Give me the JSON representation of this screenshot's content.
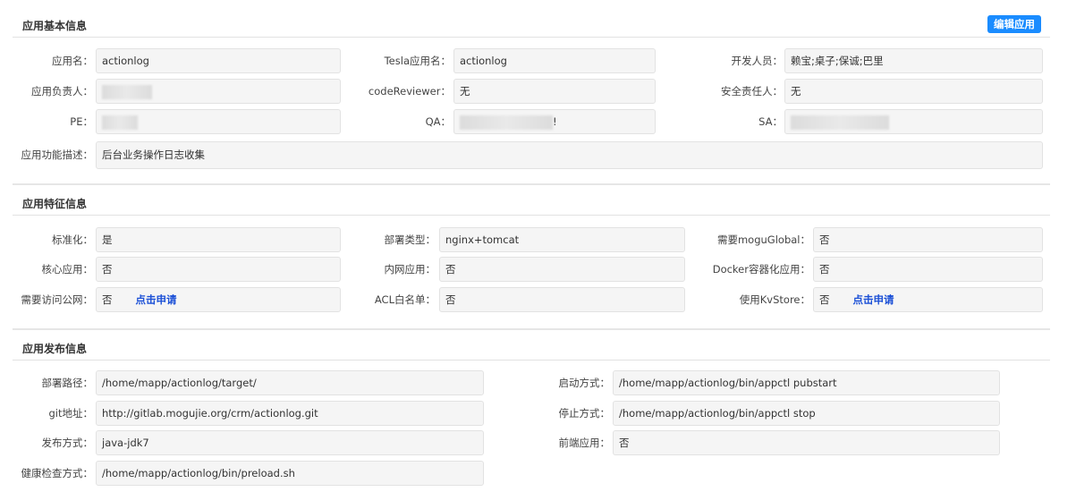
{
  "basic": {
    "title": "应用基本信息",
    "edit_button": "编辑应用",
    "labels": {
      "app_name": "应用名：",
      "tesla_name": "Tesla应用名：",
      "developers": "开发人员：",
      "owner": "应用负责人：",
      "code_reviewer": "codeReviewer：",
      "security_owner": "安全责任人：",
      "pe": "PE：",
      "qa": "QA：",
      "sa": "SA：",
      "description": "应用功能描述："
    },
    "values": {
      "app_name": "actionlog",
      "tesla_name": "actionlog",
      "developers": "赖宝;桌子;保诚;巴里",
      "code_reviewer": "无",
      "security_owner": "无",
      "qa_suffix": "!",
      "description": "后台业务操作日志收集"
    }
  },
  "features": {
    "title": "应用特征信息",
    "labels": {
      "standardized": "标准化：",
      "deploy_type": "部署类型：",
      "mogu_global": "需要moguGlobal：",
      "core_app": "核心应用：",
      "intranet_app": "内网应用：",
      "docker": "Docker容器化应用：",
      "public_network": "需要访问公网：",
      "acl": "ACL白名单：",
      "kvstore": "使用KvStore："
    },
    "values": {
      "standardized": "是",
      "deploy_type": "nginx+tomcat",
      "mogu_global": "否",
      "core_app": "否",
      "intranet_app": "否",
      "docker": "否",
      "public_network": "否",
      "acl": "否",
      "kvstore": "否"
    },
    "apply_link": "点击申请"
  },
  "release": {
    "title": "应用发布信息",
    "labels": {
      "deploy_path": "部署路径：",
      "start_method": "启动方式：",
      "git_url": "git地址：",
      "stop_method": "停止方式：",
      "release_method": "发布方式：",
      "frontend_app": "前端应用：",
      "health_check": "健康检查方式："
    },
    "values": {
      "deploy_path": "/home/mapp/actionlog/target/",
      "start_method": "/home/mapp/actionlog/bin/appctl pubstart",
      "git_url": "http://gitlab.mogujie.org/crm/actionlog.git",
      "stop_method": "/home/mapp/actionlog/bin/appctl stop",
      "release_method": "java-jdk7",
      "frontend_app": "否",
      "health_check": "/home/mapp/actionlog/bin/preload.sh"
    }
  }
}
